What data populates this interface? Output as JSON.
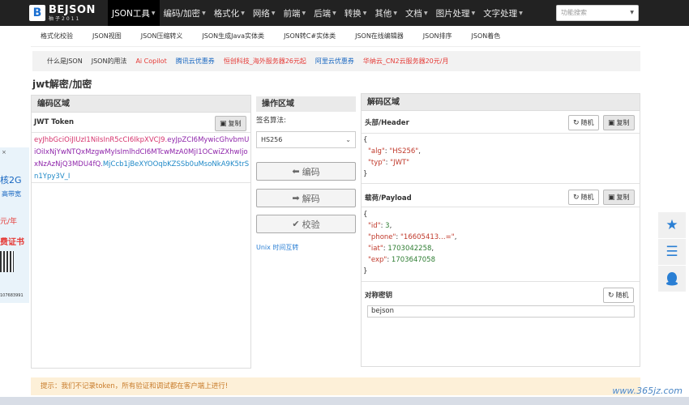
{
  "logo": {
    "name": "BEJSON",
    "sub": "柚子2011",
    "mark": "B"
  },
  "nav": {
    "items": [
      {
        "label": "JSON工具",
        "active": true
      },
      {
        "label": "编码/加密"
      },
      {
        "label": "格式化"
      },
      {
        "label": "网络"
      },
      {
        "label": "前端"
      },
      {
        "label": "后端"
      },
      {
        "label": "转换"
      },
      {
        "label": "其他"
      },
      {
        "label": "文档"
      },
      {
        "label": "图片处理"
      },
      {
        "label": "文字处理"
      }
    ],
    "search_placeholder": "功能搜索"
  },
  "subnav": [
    "格式化校验",
    "JSON视图",
    "JSON压缩转义",
    "JSON生成Java实体类",
    "JSON转C#实体类",
    "JSON在线编辑器",
    "JSON排序",
    "JSON着色"
  ],
  "linkbar": [
    {
      "label": "什么是JSON",
      "color": "#333333"
    },
    {
      "label": "JSON的用法",
      "color": "#333333"
    },
    {
      "label": "Ai Copilot",
      "color": "#e53935"
    },
    {
      "label": "腾讯云优惠券",
      "color": "#1565c0"
    },
    {
      "label": "恒创科技_海外服务器26元起",
      "color": "#e53935"
    },
    {
      "label": "阿里云优惠券",
      "color": "#1565c0"
    },
    {
      "label": "华纳云_CN2云服务器20元/月",
      "color": "#e53935"
    }
  ],
  "page_title": "jwt解密/加密",
  "encode_panel": {
    "title": "编码区域",
    "token_label": "JWT Token",
    "copy_label": "复制",
    "token_header": "eyJhbGciOiJIUzI1NiIsInR5cCI6IkpXVCJ9.",
    "token_payload": "eyJpZCI6MywicGhvbmUiOiIxNjYwNTQxMzgwMyIsImlhdCI6MTcwMzA0MjI1OCwiZXhwIjoxNzAzNjQ3MDU4fQ.",
    "token_signature": "MjCcb1jBeXYOOqbKZSSb0uMsoNkA9K5trSn1Ypy3V_I"
  },
  "operation": {
    "title": "操作区域",
    "algo_label": "签名算法:",
    "algo_value": "HS256",
    "encode_btn": "编码",
    "decode_btn": "解码",
    "verify_btn": "校验",
    "unix_link": "Unix 时间互转"
  },
  "decode_panel": {
    "title": "解码区域",
    "header_label": "头部/Header",
    "payload_label": "载荷/Payload",
    "secret_label": "对称密钥",
    "random_label": "随机",
    "copy_label": "复制",
    "header_lines": {
      "open": "{",
      "alg_key": "\"alg\"",
      "alg_val": "\"HS256\"",
      "typ_key": "\"typ\"",
      "typ_val": "\"JWT\"",
      "close": "}"
    },
    "payload_lines": {
      "open": "{",
      "id_key": "\"id\"",
      "id_val": "3",
      "phone_key": "\"phone\"",
      "phone_val": "\"16605413…=\"",
      "iat_key": "\"iat\"",
      "iat_val": "1703042258",
      "exp_key": "\"exp\"",
      "exp_val": "1703647058",
      "close": "}"
    },
    "secret_value": "bejson"
  },
  "notice": "提示：我们不记录token，所有验证和调试都在客户端上进行!",
  "left_ad": {
    "close": "×",
    "line1": "核2G",
    "line2": "高带宽",
    "line3": "元/年",
    "line4": "费证书",
    "line5": "107683991"
  },
  "watermark": "www.365jz.com",
  "colors": {
    "nav_bg": "#222222",
    "notice_bg": "#fdf0d8",
    "accent": "#2a7fd4"
  }
}
